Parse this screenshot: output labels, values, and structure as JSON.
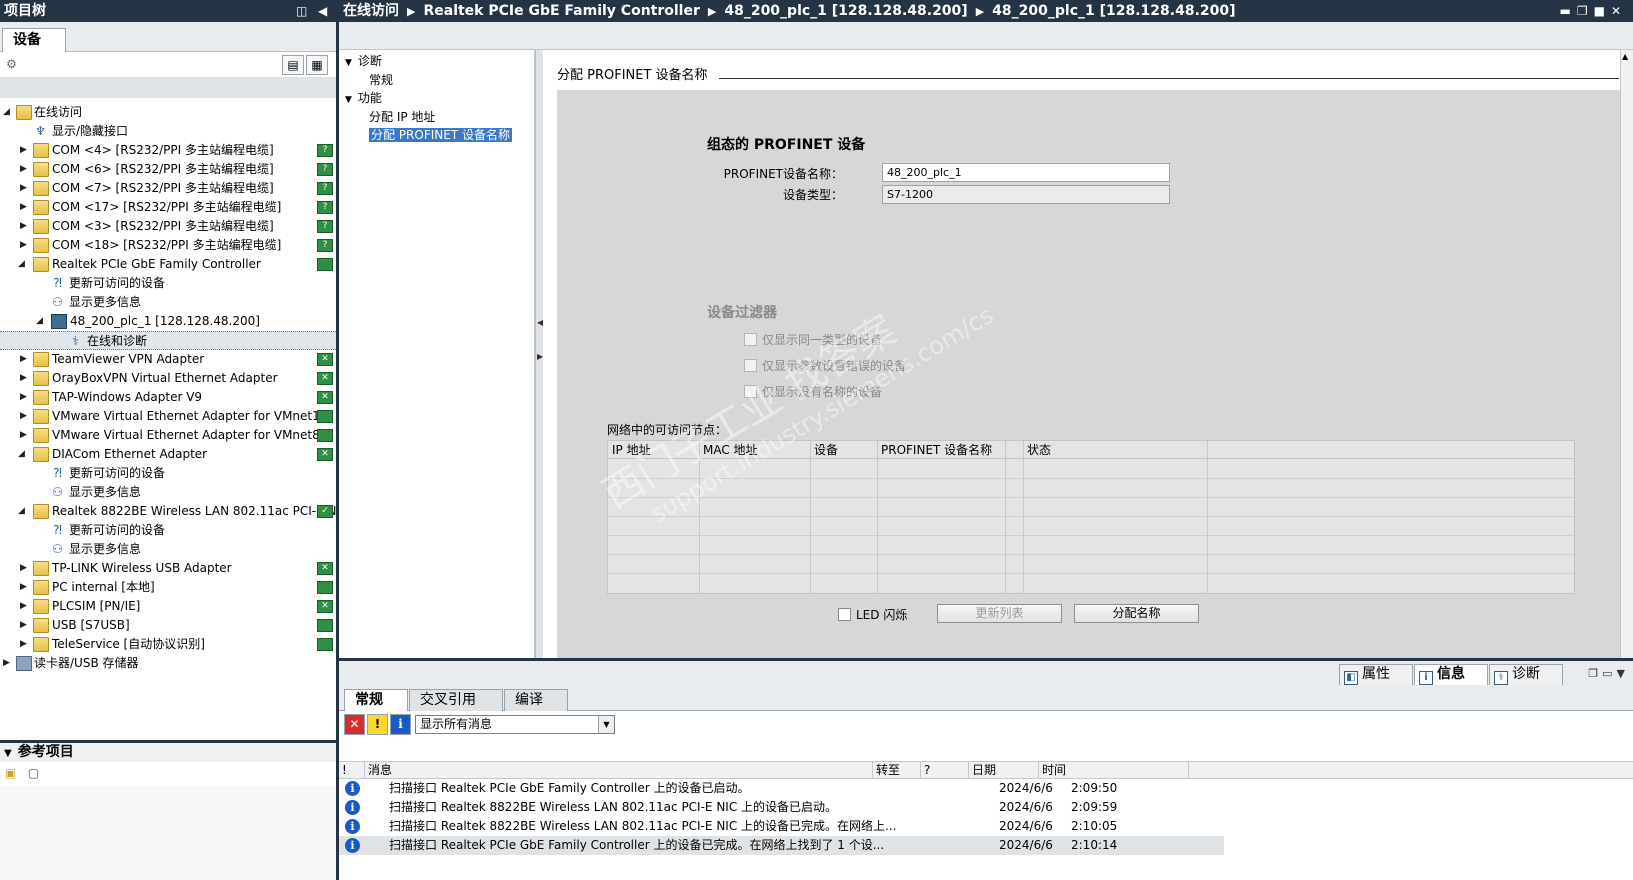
{
  "project_tree": {
    "title": "项目树",
    "tab_label": "设备",
    "rows": [
      {
        "label": "在线访问",
        "icon": "online-access-icon",
        "expanded": true
      },
      {
        "label": "显示/隐藏接口",
        "icon": "toggle-interfaces-icon"
      },
      {
        "label": "COM <4> [RS232/PPI 多主站编程电缆]",
        "icon": "folder-icon"
      },
      {
        "label": "COM <6> [RS232/PPI 多主站编程电缆]",
        "icon": "folder-icon"
      },
      {
        "label": "COM <7> [RS232/PPI 多主站编程电缆]",
        "icon": "folder-icon"
      },
      {
        "label": "COM <17> [RS232/PPI 多主站编程电缆]",
        "icon": "folder-icon"
      },
      {
        "label": "COM <3> [RS232/PPI 多主站编程电缆]",
        "icon": "folder-icon"
      },
      {
        "label": "COM <18> [RS232/PPI 多主站编程电缆]",
        "icon": "folder-icon"
      },
      {
        "label": "Realtek PCIe GbE Family Controller",
        "icon": "folder-icon",
        "expanded": true
      },
      {
        "label": "更新可访问的设备",
        "icon": "update-devices-icon"
      },
      {
        "label": "显示更多信息",
        "icon": "more-info-icon"
      },
      {
        "label": "48_200_plc_1 [128.128.48.200]",
        "icon": "plc-icon",
        "expanded": true
      },
      {
        "label": "在线和诊断",
        "icon": "diagnostics-icon",
        "selected": true
      },
      {
        "label": "TeamViewer VPN Adapter",
        "icon": "folder-icon"
      },
      {
        "label": "OrayBoxVPN Virtual Ethernet Adapter",
        "icon": "folder-icon"
      },
      {
        "label": "TAP-Windows Adapter V9",
        "icon": "folder-icon"
      },
      {
        "label": "VMware Virtual Ethernet Adapter for VMnet1",
        "icon": "folder-icon"
      },
      {
        "label": "VMware Virtual Ethernet Adapter for VMnet8",
        "icon": "folder-icon"
      },
      {
        "label": "DIACom Ethernet Adapter",
        "icon": "folder-icon",
        "expanded": true
      },
      {
        "label": "更新可访问的设备",
        "icon": "update-devices-icon"
      },
      {
        "label": "显示更多信息",
        "icon": "more-info-icon"
      },
      {
        "label": "Realtek 8822BE Wireless LAN 802.11ac PCI-E NIC",
        "icon": "folder-icon",
        "expanded": true
      },
      {
        "label": "更新可访问的设备",
        "icon": "update-devices-icon"
      },
      {
        "label": "显示更多信息",
        "icon": "more-info-icon"
      },
      {
        "label": "TP-LINK Wireless USB Adapter",
        "icon": "folder-icon"
      },
      {
        "label": "PC internal [本地]",
        "icon": "folder-icon"
      },
      {
        "label": "PLCSIM [PN/IE]",
        "icon": "folder-icon"
      },
      {
        "label": "USB [S7USB]",
        "icon": "folder-icon"
      },
      {
        "label": "TeleService [自动协议识别]",
        "icon": "folder-icon"
      },
      {
        "label": "读卡器/USB 存储器",
        "icon": "card-reader-icon"
      }
    ],
    "reference_title": "参考项目"
  },
  "header": {
    "breadcrumb": [
      "在线访问",
      "Realtek PCIe GbE Family Controller",
      "48_200_plc_1 [128.128.48.200]",
      "48_200_plc_1 [128.128.48.200]"
    ]
  },
  "nav": {
    "groups": [
      {
        "label": "诊断",
        "items": [
          "常规"
        ]
      },
      {
        "label": "功能",
        "items": [
          "分配 IP 地址",
          "分配 PROFINET 设备名称"
        ]
      }
    ],
    "active_item": "分配 PROFINET 设备名称"
  },
  "content": {
    "title": "分配 PROFINET 设备名称",
    "configured_heading": "组态的 PROFINET 设备",
    "name_label": "PROFINET设备名称：",
    "name_value": "48_200_plc_1",
    "type_label": "设备类型：",
    "type_value": "S7-1200",
    "filter_heading": "设备过滤器",
    "filters": [
      "仅显示同一类型的设备",
      "仅显示参数设置错误的设备",
      "仅显示没有名称的设备"
    ],
    "nodes_label": "网络中的可访问节点：",
    "columns": [
      "IP 地址",
      "MAC 地址",
      "设备",
      "PROFINET 设备名称",
      "状态"
    ],
    "led_label": "LED 闪烁",
    "update_button": "更新列表",
    "assign_button": "分配名称"
  },
  "watermark": {
    "line1": "西门子工业 找答案",
    "line2": "support.industry.siemens.com/cs"
  },
  "inspector_tabs": [
    "属性",
    "信息",
    "诊断"
  ],
  "info": {
    "tabs": [
      "常规",
      "交叉引用",
      "编译"
    ],
    "filter_value": "显示所有消息",
    "columns": [
      "!",
      "消息",
      "转至",
      "?",
      "日期",
      "时间"
    ],
    "messages": [
      {
        "text": "扫描接口 Realtek PCIe GbE Family Controller 上的设备已启动。",
        "date": "2024/6/6",
        "time": "2:09:50"
      },
      {
        "text": "扫描接口 Realtek 8822BE Wireless LAN 802.11ac PCI-E NIC 上的设备已启动。",
        "date": "2024/6/6",
        "time": "2:09:59"
      },
      {
        "text": "扫描接口 Realtek 8822BE Wireless LAN 802.11ac PCI-E NIC 上的设备已完成。在网络上...",
        "date": "2024/6/6",
        "time": "2:10:05"
      },
      {
        "text": "扫描接口 Realtek PCIe GbE Family Controller 上的设备已完成。在网络上找到了 1 个设...",
        "date": "2024/6/6",
        "time": "2:10:14"
      }
    ]
  },
  "colors": {
    "title_bar": "#253444",
    "selection": "#3a78c9",
    "info_icon": "#1b59c4"
  }
}
